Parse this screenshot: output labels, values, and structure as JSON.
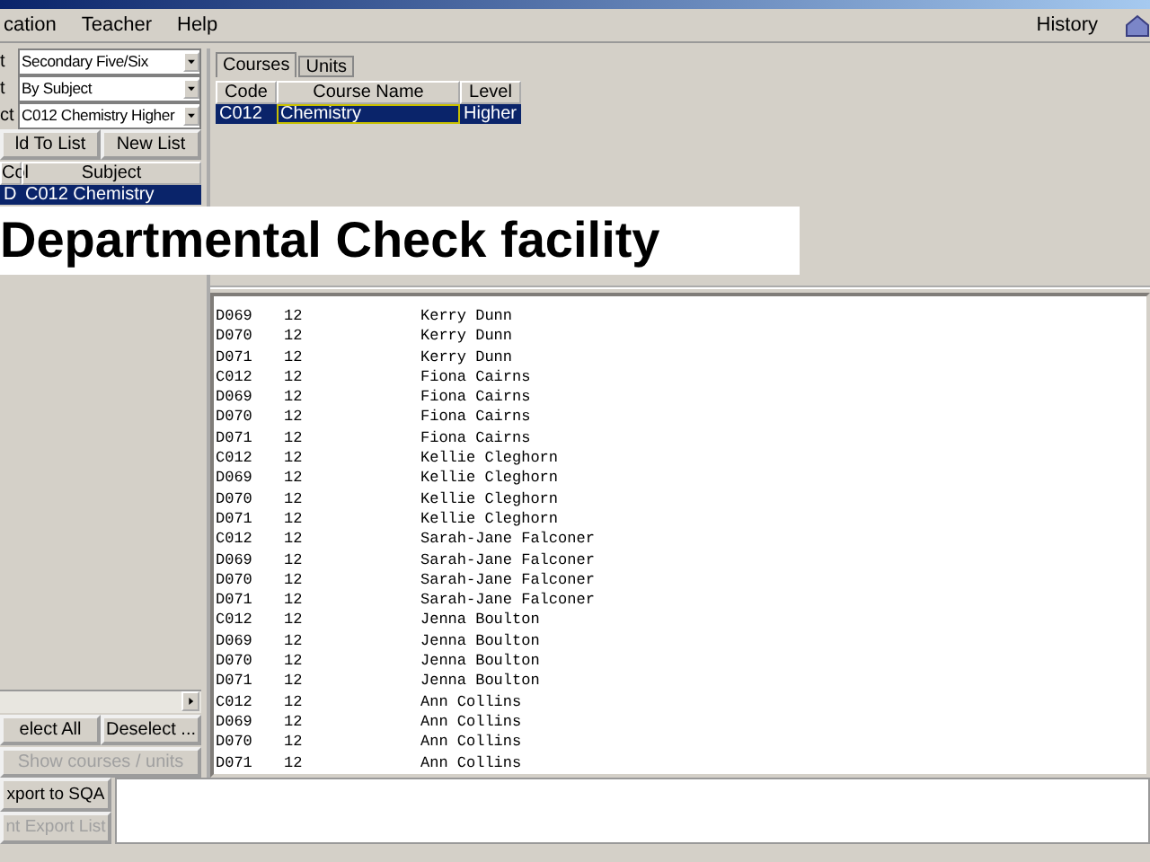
{
  "menu": [
    "cation",
    "Teacher",
    "Help"
  ],
  "history": "History",
  "filters": [
    {
      "label": "t",
      "value": "Secondary Five/Six"
    },
    {
      "label": "t",
      "value": "By Subject"
    },
    {
      "label": "ct",
      "value": "C012 Chemistry Higher"
    }
  ],
  "list_buttons": [
    "ld To List",
    "New List"
  ],
  "subject_table": {
    "columns": [
      "Col",
      "Subject"
    ],
    "rows": [
      {
        "cells": [
          "D",
          "C012 Chemistry"
        ],
        "selected": true
      }
    ]
  },
  "select_buttons": [
    {
      "label": "elect All",
      "disabled": false
    },
    {
      "label": "Deselect ...",
      "disabled": false
    }
  ],
  "show_button": {
    "label": "Show courses / units",
    "disabled": true
  },
  "export_buttons": [
    {
      "label": "xport to SQA",
      "disabled": false
    },
    {
      "label": "nt Export List",
      "disabled": true
    }
  ],
  "tabs": [
    {
      "label": "Courses",
      "selected": true
    },
    {
      "label": "Units",
      "selected": false
    }
  ],
  "course_table": {
    "columns": [
      "Code",
      "Course Name",
      "Level"
    ],
    "rows": [
      {
        "cells": [
          "C012",
          "Chemistry",
          "Higher"
        ],
        "selected": true
      }
    ]
  },
  "banner": "Departmental Check facility",
  "records": [
    [
      "D069",
      "12",
      "Kerry Dunn"
    ],
    [
      "D070",
      "12",
      "Kerry Dunn"
    ],
    [
      "D071",
      "12",
      "Kerry Dunn"
    ],
    [
      "C012",
      "12",
      "Fiona Cairns"
    ],
    [
      "D069",
      "12",
      "Fiona Cairns"
    ],
    [
      "D070",
      "12",
      "Fiona Cairns"
    ],
    [
      "D071",
      "12",
      "Fiona Cairns"
    ],
    [
      "C012",
      "12",
      "Kellie Cleghorn"
    ],
    [
      "D069",
      "12",
      "Kellie Cleghorn"
    ],
    [
      "D070",
      "12",
      "Kellie Cleghorn"
    ],
    [
      "D071",
      "12",
      "Kellie Cleghorn"
    ],
    [
      "C012",
      "12",
      "Sarah-Jane Falconer"
    ],
    [
      "D069",
      "12",
      "Sarah-Jane Falconer"
    ],
    [
      "D070",
      "12",
      "Sarah-Jane Falconer"
    ],
    [
      "D071",
      "12",
      "Sarah-Jane Falconer"
    ],
    [
      "C012",
      "12",
      "Jenna Boulton"
    ],
    [
      "D069",
      "12",
      "Jenna Boulton"
    ],
    [
      "D070",
      "12",
      "Jenna Boulton"
    ],
    [
      "D071",
      "12",
      "Jenna Boulton"
    ],
    [
      "C012",
      "12",
      "Ann Collins"
    ],
    [
      "D069",
      "12",
      "Ann Collins"
    ],
    [
      "D070",
      "12",
      "Ann Collins"
    ],
    [
      "D071",
      "12",
      "Ann Collins"
    ]
  ]
}
